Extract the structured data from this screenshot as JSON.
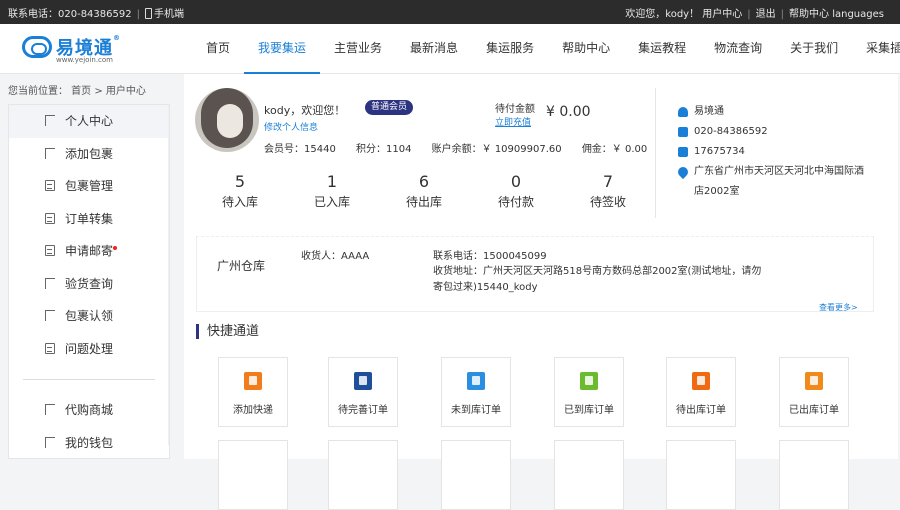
{
  "topbar": {
    "hotline": "联系电话：020-84386592",
    "mobile": "手机端",
    "welcome": "欢迎您，kody！ 用户中心",
    "logout": "退出",
    "help": "帮助中心",
    "languages": "languages"
  },
  "logo": {
    "name": "易境通",
    "url": "www.yejoin.com",
    "reg": "®"
  },
  "nav": [
    "首页",
    "我要集运",
    "主营业务",
    "最新消息",
    "集运服务",
    "帮助中心",
    "集运教程",
    "物流查询",
    "关于我们",
    "采集插件"
  ],
  "breadcrumb": "您当前位置： 首页 > 用户中心",
  "sidebar": {
    "items": [
      "个人中心",
      "添加包裹",
      "包裹管理",
      "订单转集",
      "申请邮寄",
      "验货查询",
      "包裹认领",
      "问题处理"
    ],
    "items2": [
      "代购商城",
      "我的钱包"
    ]
  },
  "profile": {
    "greeting": "kody，欢迎您！",
    "level": "普通会员",
    "edit": "修改个人信息",
    "pay_label": "待付金额",
    "pay_action": "立即充值",
    "pay_value": "¥ 0.00",
    "member_no": "会员号：15440",
    "points": "积分：1104",
    "balance": "账户余额：￥ 10909907.60",
    "commission": "佣金：￥ 0.00"
  },
  "stats": [
    {
      "n": "5",
      "t": "待入库"
    },
    {
      "n": "1",
      "t": "已入库"
    },
    {
      "n": "6",
      "t": "待出库"
    },
    {
      "n": "0",
      "t": "待付款"
    },
    {
      "n": "7",
      "t": "待签收"
    }
  ],
  "contact": {
    "name": "易境通",
    "tel": "020-84386592",
    "mobile": "17675734",
    "address": "广东省广州市天河区天河北中海国际酒店2002室"
  },
  "warehouse": {
    "name": "广州仓库",
    "receiver": "收货人：AAAA",
    "tel": "联系电话：1500045099",
    "address": "收货地址：广州天河区天河路518号南方数码总部2002室(测试地址，请勿寄包过来)15440_kody",
    "more": "查看更多>"
  },
  "quick": {
    "title": "快捷通道",
    "tiles": [
      {
        "label": "添加快递",
        "color": "#f07c1b"
      },
      {
        "label": "待完善订单",
        "color": "#1d4f9a"
      },
      {
        "label": "未到库订单",
        "color": "#2a8fe0"
      },
      {
        "label": "已到库订单",
        "color": "#6cba2d"
      },
      {
        "label": "待出库订单",
        "color": "#f06a14"
      },
      {
        "label": "已出库订单",
        "color": "#f08a1b"
      }
    ]
  }
}
